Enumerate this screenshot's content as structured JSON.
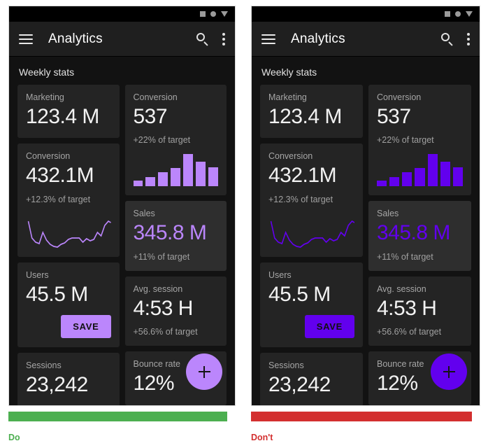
{
  "panels": [
    {
      "verdict": "Do",
      "verdict_color": "#4CAF50",
      "accent": "#BB86FC",
      "statusbar": {
        "icon_square": "square-icon",
        "icon_circle": "circle-icon",
        "icon_triangle": "triangle-icon"
      },
      "appbar": {
        "menu": "hamburger-menu-icon",
        "title": "Analytics",
        "search": "search-icon",
        "overflow": "overflow-menu-icon"
      },
      "section_label": "Weekly stats",
      "fab_label": "+",
      "cards": {
        "marketing": {
          "label": "Marketing",
          "value": "123.4 M"
        },
        "conversion_count": {
          "label": "Conversion",
          "value": "537",
          "sub": "+22% of target"
        },
        "conversion_amount": {
          "label": "Conversion",
          "value": "432.1M",
          "sub": "+12.3% of target"
        },
        "sales": {
          "label": "Sales",
          "value": "345.8 M",
          "sub": "+11% of target"
        },
        "users": {
          "label": "Users",
          "value": "45.5 M",
          "save_label": "SAVE"
        },
        "avg_session": {
          "label": "Avg. session",
          "value": "4:53 H",
          "sub": "+56.6% of target"
        },
        "sessions": {
          "label": "Sessions",
          "value": "23,242"
        },
        "bounce_rate": {
          "label": "Bounce rate",
          "value": "12%"
        }
      }
    },
    {
      "verdict": "Don't",
      "verdict_color": "#D32F2F",
      "accent": "#6200EE",
      "statusbar": {
        "icon_square": "square-icon",
        "icon_circle": "circle-icon",
        "icon_triangle": "triangle-icon"
      },
      "appbar": {
        "menu": "hamburger-menu-icon",
        "title": "Analytics",
        "search": "search-icon",
        "overflow": "overflow-menu-icon"
      },
      "section_label": "Weekly stats",
      "fab_label": "+",
      "cards": {
        "marketing": {
          "label": "Marketing",
          "value": "123.4 M"
        },
        "conversion_count": {
          "label": "Conversion",
          "value": "537",
          "sub": "+22% of target"
        },
        "conversion_amount": {
          "label": "Conversion",
          "value": "432.1M",
          "sub": "+12.3% of target"
        },
        "sales": {
          "label": "Sales",
          "value": "345.8 M",
          "sub": "+11% of target"
        },
        "users": {
          "label": "Users",
          "value": "45.5 M",
          "save_label": "SAVE"
        },
        "avg_session": {
          "label": "Avg. session",
          "value": "4:53 H",
          "sub": "+56.6% of target"
        },
        "sessions": {
          "label": "Sessions",
          "value": "23,242"
        },
        "bounce_rate": {
          "label": "Bounce rate",
          "value": "12%"
        }
      }
    }
  ],
  "chart_data": [
    {
      "type": "bar",
      "title": "Conversion",
      "categories": [
        "1",
        "2",
        "3",
        "4",
        "5",
        "6",
        "7"
      ],
      "values": [
        18,
        30,
        44,
        58,
        100,
        76,
        60
      ],
      "ylim": [
        0,
        100
      ],
      "xlabel": "",
      "ylabel": "",
      "grid": false,
      "legend": "none"
    },
    {
      "type": "line",
      "title": "Conversion",
      "x": [
        0,
        1,
        2,
        3,
        4,
        5,
        6,
        7,
        8,
        9,
        10,
        11,
        12,
        13,
        14,
        15,
        16,
        17,
        18,
        19,
        20,
        21,
        22,
        23
      ],
      "values": [
        78,
        44,
        30,
        26,
        58,
        34,
        22,
        16,
        10,
        20,
        24,
        36,
        40,
        40,
        40,
        26,
        38,
        30,
        34,
        56,
        44,
        74,
        82,
        86
      ],
      "ylim": [
        0,
        100
      ],
      "xlabel": "",
      "ylabel": "",
      "grid": false,
      "legend": "none"
    }
  ]
}
